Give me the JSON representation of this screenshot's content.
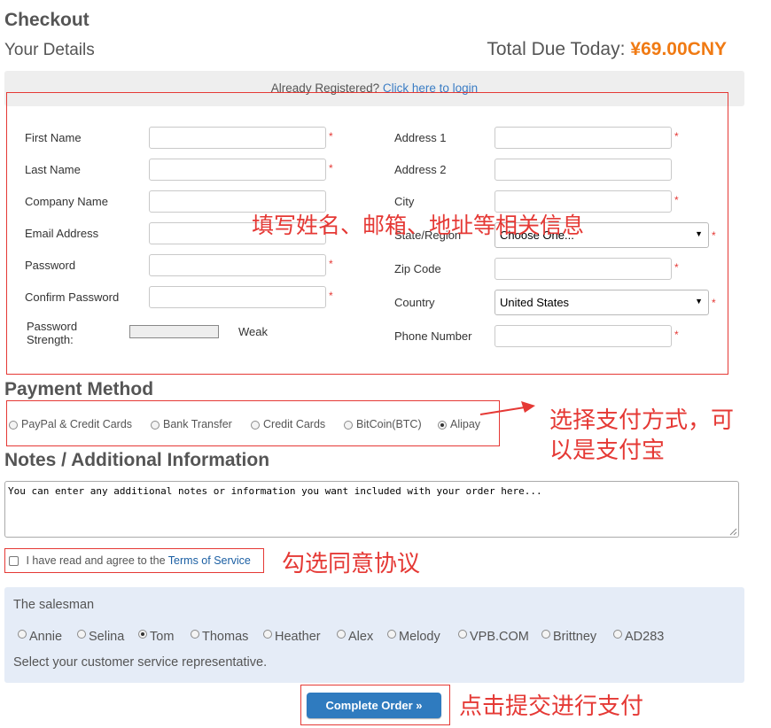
{
  "header": {
    "title": "Checkout",
    "subtitle": "Your Details",
    "total_label": "Total Due Today:",
    "total_amount": "¥69.00CNY"
  },
  "login": {
    "prompt": "Already Registered?",
    "link": "Click here to login"
  },
  "form": {
    "first_name": "First Name",
    "last_name": "Last Name",
    "company_name": "Company Name",
    "email": "Email Address",
    "password": "Password",
    "confirm_password": "Confirm Password",
    "strength_label": "Password\nStrength:",
    "strength_value": "Weak",
    "address1": "Address 1",
    "address2": "Address 2",
    "city": "City",
    "state": "State/Region",
    "state_value": "Choose One...",
    "zip": "Zip Code",
    "country": "Country",
    "country_value": "United States",
    "phone": "Phone Number",
    "required_mark": "*"
  },
  "payment": {
    "title": "Payment Method",
    "options": [
      "PayPal & Credit Cards",
      "Bank Transfer",
      "Credit Cards",
      "BitCoin(BTC)",
      "Alipay"
    ],
    "selected": "Alipay"
  },
  "notes": {
    "title": "Notes / Additional Information",
    "placeholder": "You can enter any additional notes or information you want included with your order here..."
  },
  "terms": {
    "prefix": "I have read and agree to the",
    "link": "Terms of Service"
  },
  "salesman": {
    "title": "The salesman",
    "options": [
      "Annie",
      "Selina",
      "Tom",
      "Thomas",
      "Heather",
      "Alex",
      "Melody",
      "VPB.COM",
      "Brittney",
      "AD283"
    ],
    "selected": "Tom",
    "hint": "Select your customer service representative."
  },
  "submit_label": "Complete Order »",
  "annotations": {
    "fill_info": "填写姓名、邮箱、地址等相关信息",
    "payment_line1": "选择支付方式，可",
    "payment_line2": "以是支付宝",
    "agree": "勾选同意协议",
    "submit": "点击提交进行支付"
  },
  "colors": {
    "accent_orange": "#f07a13",
    "annotation_red": "#e53935",
    "link_blue": "#3b7dc4",
    "button_blue": "#2f7bbf",
    "salesman_panel": "#e5ecf7"
  }
}
